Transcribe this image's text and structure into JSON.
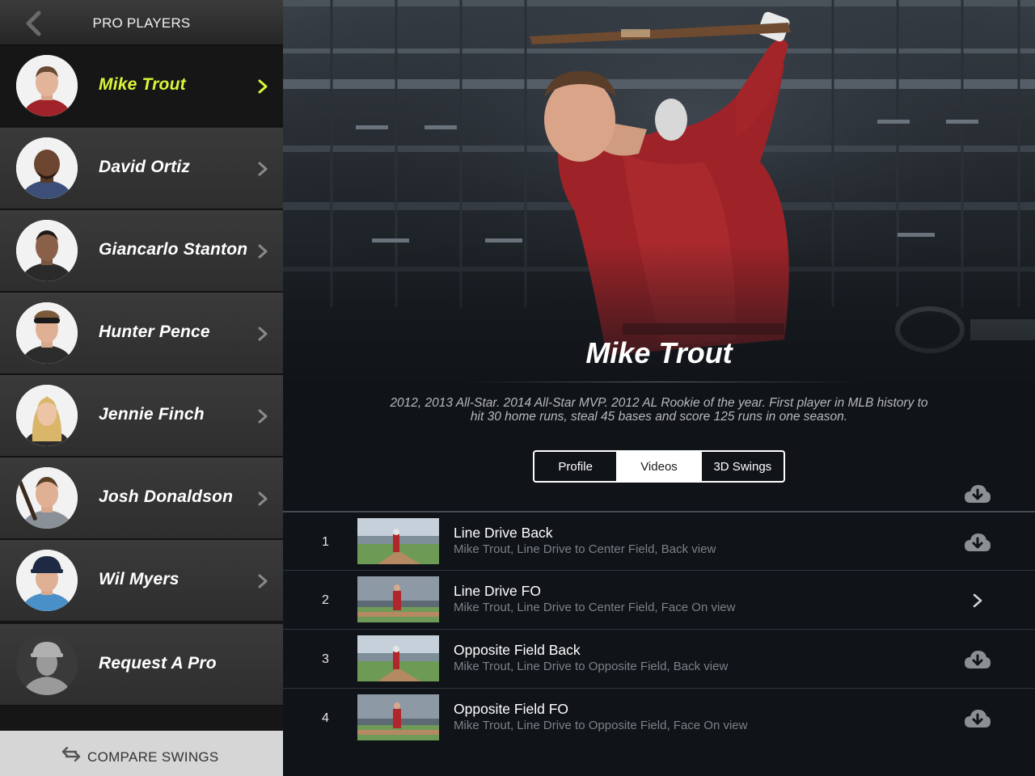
{
  "sidebar": {
    "title": "PRO PLAYERS",
    "back_icon": "chevron-left-icon",
    "players": [
      {
        "name": "Mike Trout",
        "selected": true
      },
      {
        "name": "David Ortiz",
        "selected": false
      },
      {
        "name": "Giancarlo Stanton",
        "selected": false
      },
      {
        "name": "Hunter Pence",
        "selected": false
      },
      {
        "name": "Jennie Finch",
        "selected": false
      },
      {
        "name": "Josh Donaldson",
        "selected": false
      },
      {
        "name": "Wil Myers",
        "selected": false
      },
      {
        "name": "Request A Pro",
        "selected": false
      }
    ],
    "compare_label": "COMPARE SWINGS",
    "compare_icon": "swap-arrows-icon"
  },
  "main": {
    "player_name": "Mike Trout",
    "bio": "2012, 2013 All-Star. 2014 All-Star MVP. 2012 AL Rookie of the year. First player in MLB history to hit 30 home runs, steal 45 bases and score 125 runs in one season.",
    "tabs": [
      {
        "label": "Profile",
        "active": false
      },
      {
        "label": "Videos",
        "active": true
      },
      {
        "label": "3D Swings",
        "active": false
      }
    ],
    "download_all_icon": "cloud-download-icon",
    "videos": [
      {
        "num": "1",
        "title": "Line Drive Back",
        "subtitle": "Mike Trout, Line Drive to Center Field, Back view",
        "action": "cloud-download-icon"
      },
      {
        "num": "2",
        "title": "Line Drive FO",
        "subtitle": "Mike Trout, Line Drive to Center Field, Face On view",
        "action": "chevron-right-icon"
      },
      {
        "num": "3",
        "title": "Opposite Field Back",
        "subtitle": "Mike Trout, Line Drive to Opposite Field, Back view",
        "action": "cloud-download-icon"
      },
      {
        "num": "4",
        "title": "Opposite Field FO",
        "subtitle": "Mike Trout, Line Drive to Opposite Field, Face On view",
        "action": "cloud-download-icon"
      }
    ]
  },
  "colors": {
    "accent": "#dcf53a",
    "sidebar_row": "#353535",
    "main_bg": "#101418",
    "jersey_red": "#a3252a"
  }
}
